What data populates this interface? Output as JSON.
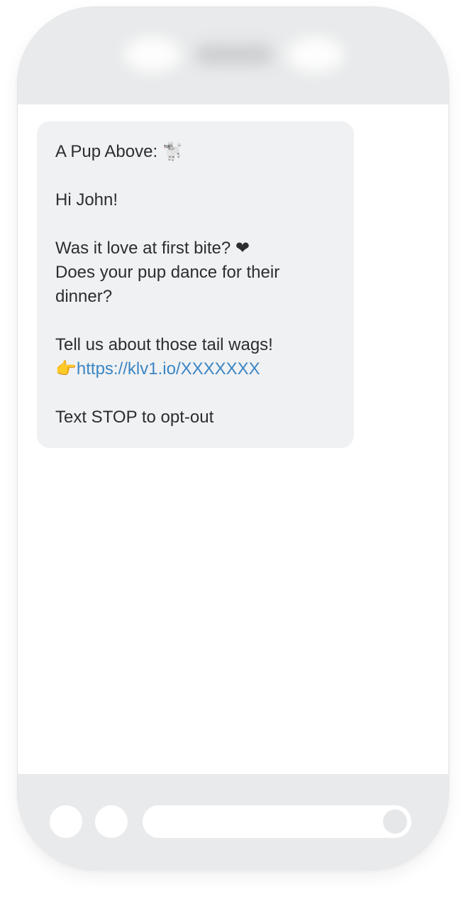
{
  "message": {
    "line1": "A Pup Above: 🐩",
    "line2": "Hi John!",
    "line3": "Was it love at first bite? ❤",
    "line4": "Does your pup dance for their dinner?",
    "line5": "Tell us about those tail wags!",
    "pointer": "👉",
    "link": "https://klv1.io/XXXXXXX",
    "line7": "Text STOP to opt-out"
  },
  "icons": {
    "left_button_1": "plus-icon",
    "left_button_2": "camera-icon",
    "send": "send-icon"
  },
  "colors": {
    "bubble": "#f0f1f2",
    "link": "#3b86c4",
    "chrome": "#e9eaeb"
  }
}
